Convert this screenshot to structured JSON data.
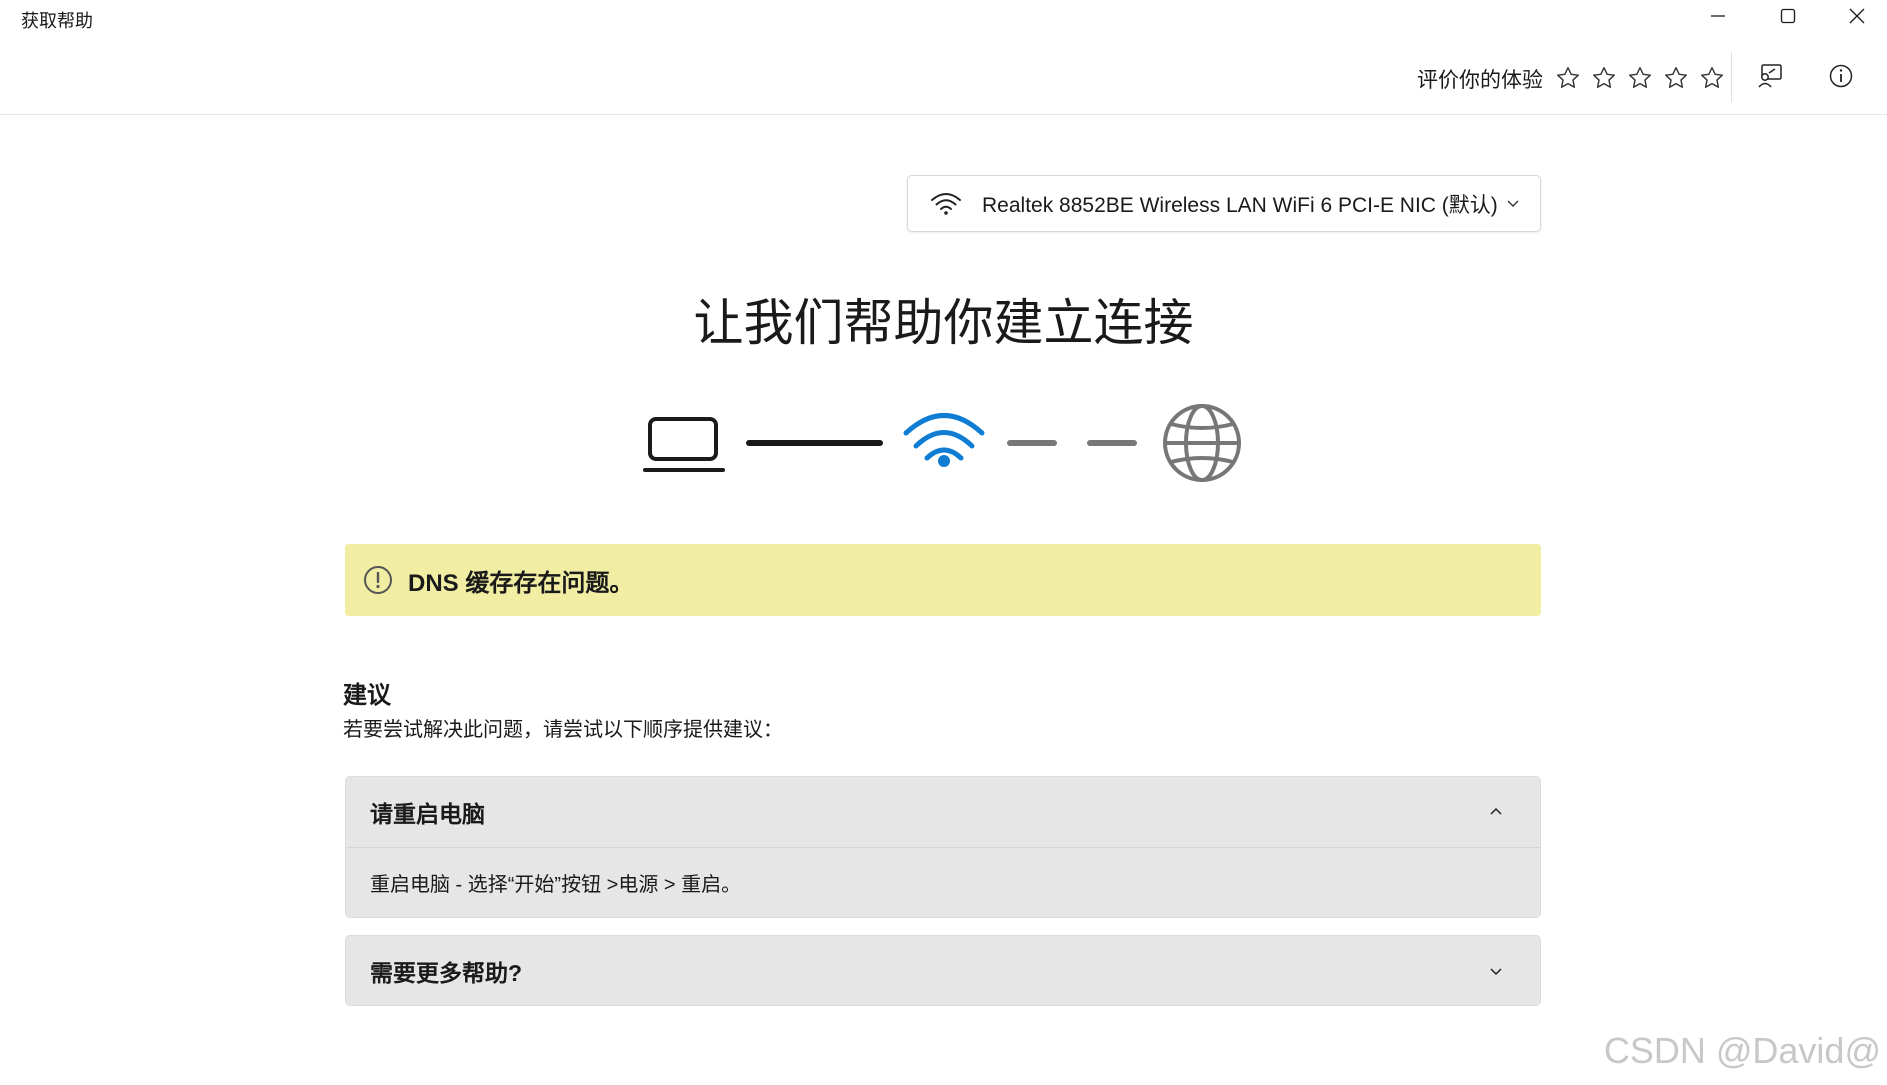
{
  "window": {
    "title": "获取帮助",
    "controls": [
      "minimize-icon",
      "maximize-icon",
      "close-icon"
    ]
  },
  "header": {
    "rate_label": "评价你的体验",
    "stars": 5,
    "icons": [
      "feedback-icon",
      "info-icon"
    ]
  },
  "adapter": {
    "icon": "wifi-icon",
    "name": "Realtek 8852BE Wireless LAN WiFi 6 PCI-E NIC (默认)"
  },
  "main": {
    "title": "让我们帮助你建立连接"
  },
  "diagram": {
    "nodes": [
      "laptop-icon",
      "wifi-icon",
      "globe-icon"
    ],
    "accent_color": "#0f7dd4"
  },
  "alert": {
    "icon": "exclamation-circle-icon",
    "text": "DNS 缓存存在问题。",
    "background": "#f1eda3"
  },
  "suggestions": {
    "title": "建议",
    "description": "若要尝试解决此问题，请尝试以下顺序提供建议：",
    "cards": [
      {
        "title": "请重启电脑",
        "expanded": true,
        "body": "重启电脑 - 选择“开始”按钮 >电源 > 重启。"
      },
      {
        "title": "需要更多帮助?",
        "expanded": false
      }
    ]
  },
  "watermark": "CSDN @David@"
}
